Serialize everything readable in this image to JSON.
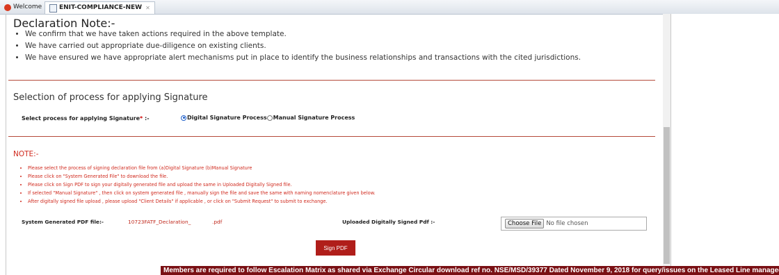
{
  "tabs": [
    {
      "label": "Welcome"
    },
    {
      "label": "ENIT-COMPLIANCE-NEW"
    }
  ],
  "declaration": {
    "title": "Declaration Note:-",
    "items": [
      "We confirm that we have taken actions required in the above template.",
      "We have carried out appropriate due-diligence on existing clients.",
      "We have ensured we have appropriate alert mechanisms put in place to identify the business relationships and transactions with the cited jurisdictions."
    ]
  },
  "signature": {
    "section_title": "Selection of process for applying Signature",
    "field_label": "Select process for applying Signature",
    "required_mark": "*",
    "label_suffix": " :-",
    "options": [
      "Digital Signature Process",
      "Manual Signature Process"
    ],
    "selected": "Digital Signature Process"
  },
  "note": {
    "title": "NOTE:-",
    "items": [
      "Please select the process of signing declaration file from (a)Digital Signature (b)Manual Signature",
      "Please click on \"System Generated File\" to download the file.",
      "Please click on Sign PDF to sign your digitally generated file and upload the same in Uploaded Digitally Signed file.",
      "If selected \"Manual Signature\" , then click on system generated file , manually sign the file and save the same with naming nomenclature given below.",
      "After digitally signed file upload , please upload \"Client Details\" if applicable , or click on \"Submit Request\" to submit to exchange."
    ]
  },
  "files": {
    "system_label": "System Generated PDF file:-",
    "system_filename": "10723FATF_Declaration_",
    "system_ext": ".pdf",
    "uploaded_label": "Uploaded Digitally Signed Pdf :-",
    "choose_button": "Choose File",
    "no_file_text": "No file chosen"
  },
  "sign_button": "Sign PDF",
  "ticker_text": "Members are required to follow Escalation Matrix as shared via Exchange Circular download ref no. NSE/MSD/39377 Dated November 9, 2018 for query/issues on the Leased Line managed",
  "colors": {
    "accent_red": "#b01e1a",
    "note_red": "#d0291d",
    "ticker_bg": "#7a1014",
    "radio_blue": "#1f5fc9"
  }
}
